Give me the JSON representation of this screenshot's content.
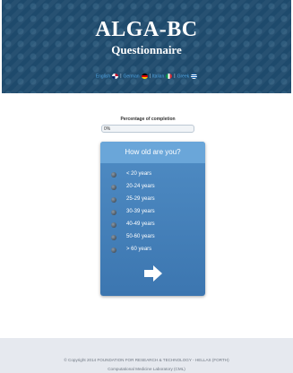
{
  "header": {
    "title": "ALGA-BC",
    "subtitle": "Questionnaire",
    "languages": [
      {
        "label": "English",
        "flag": "uk-flag-icon"
      },
      {
        "label": "German",
        "flag": "germany-flag-icon"
      },
      {
        "label": "Italian",
        "flag": "italy-flag-icon"
      },
      {
        "label": "Greek",
        "flag": "greece-flag-icon"
      }
    ],
    "separator": "|"
  },
  "progress": {
    "label": "Percentage of completion",
    "value_text": "0%",
    "percent": 0
  },
  "question": {
    "text": "How old are you?",
    "options": [
      "< 20 years",
      "20-24 years",
      "25-29 years",
      "30-39 years",
      "40-49 years",
      "50-60 years",
      "> 60 years"
    ],
    "next_icon": "right-arrow-icon"
  },
  "footer": {
    "copyright": "© Copyright 2014 FOUNDATION FOR RESEARCH & TECHNOLOGY - HELLAS (FORTH)",
    "lab": "Computational Medicine Laboratory (CML)"
  },
  "colors": {
    "header_bg": "#1e4a6c",
    "language_link": "#4fa3e0",
    "card_bg": "#4a86bf",
    "card_header": "#6aa6d9",
    "footer_bg": "#e6e9ef"
  }
}
